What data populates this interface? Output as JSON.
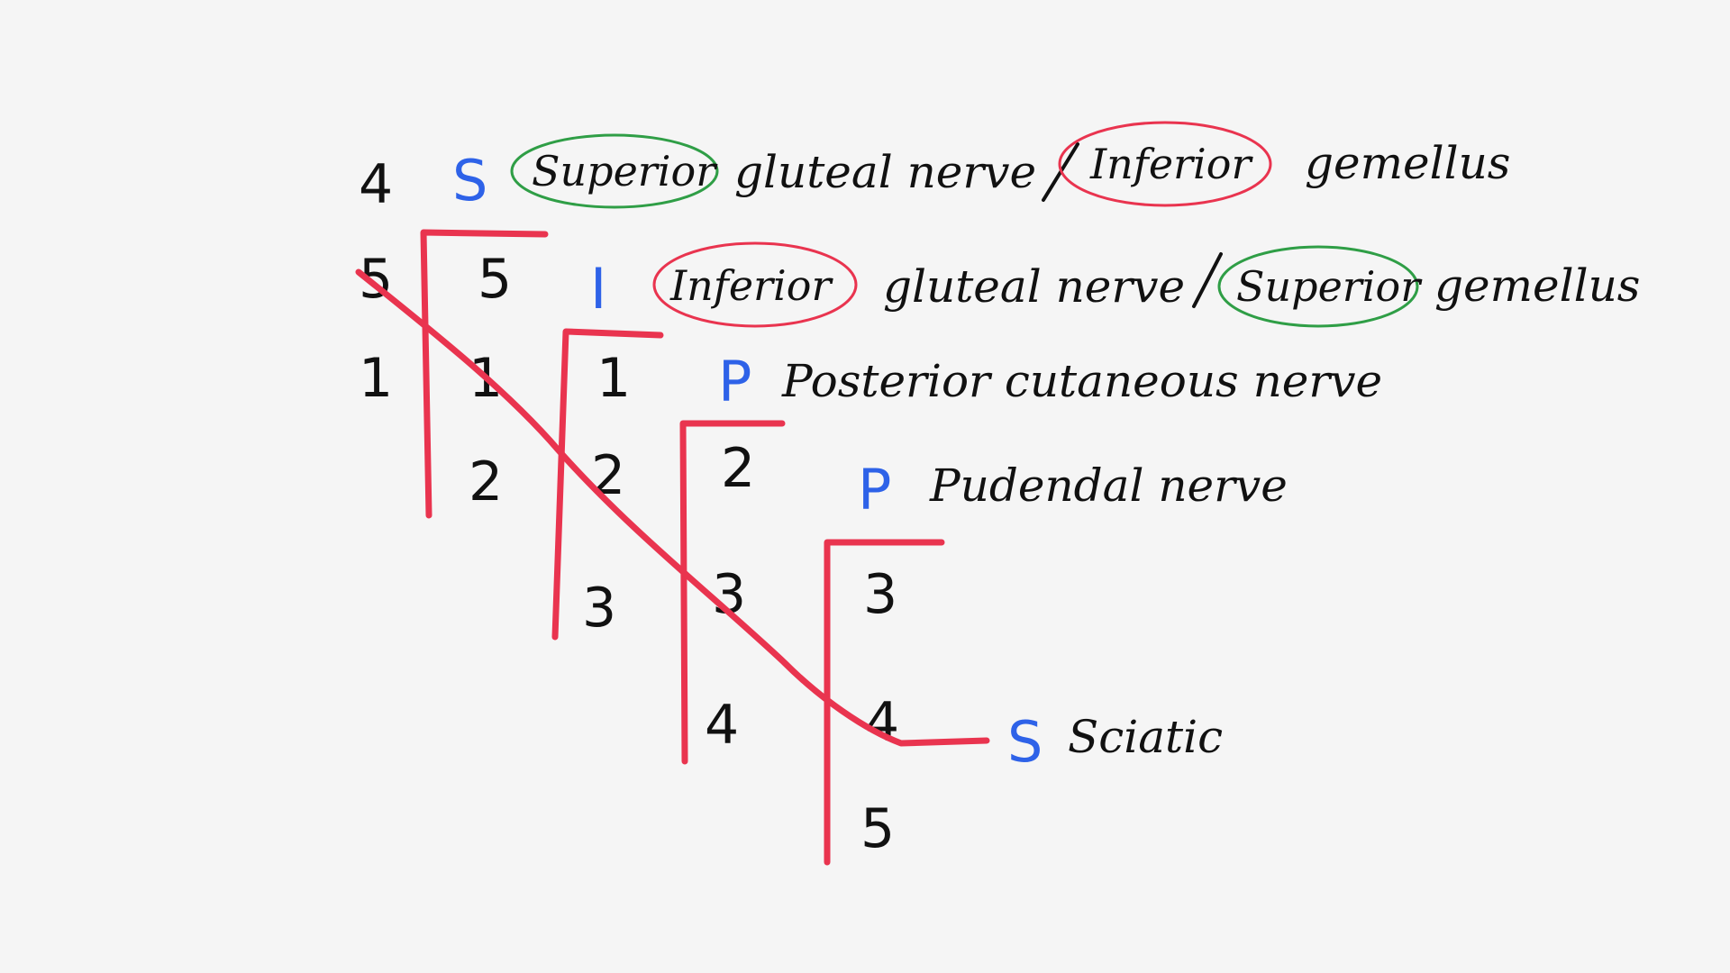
{
  "columns": {
    "c1": [
      "4",
      "5",
      "1"
    ],
    "c2": [
      "5",
      "1",
      "2"
    ],
    "c3": [
      "1",
      "2",
      "3"
    ],
    "c4": [
      "2",
      "3",
      "4"
    ],
    "c5": [
      "3",
      "4",
      "5"
    ]
  },
  "rows": {
    "superior": {
      "letter": "S",
      "circled_word": "Superior",
      "middle": "gluteal nerve",
      "slash": "/",
      "circled_word_2": "Inferior",
      "end": "gemellus"
    },
    "inferior": {
      "letter": "I",
      "circled_word": "Inferior",
      "middle": "gluteal nerve",
      "slash": "/",
      "circled_word_2": "Superior",
      "end": "gemellus"
    },
    "posterior": {
      "letter": "P",
      "text": "Posterior cutaneous nerve"
    },
    "pudendal": {
      "letter": "P",
      "text": "Pudendal nerve"
    },
    "sciatic": {
      "letter": "S",
      "text": "Sciatic"
    }
  },
  "colors": {
    "background": "#f5f5f5",
    "ink": "#111111",
    "letter_blue": "#2e62e8",
    "bracket_red": "#e9344f",
    "circle_green": "#2f9e46",
    "circle_red": "#e9344f"
  }
}
